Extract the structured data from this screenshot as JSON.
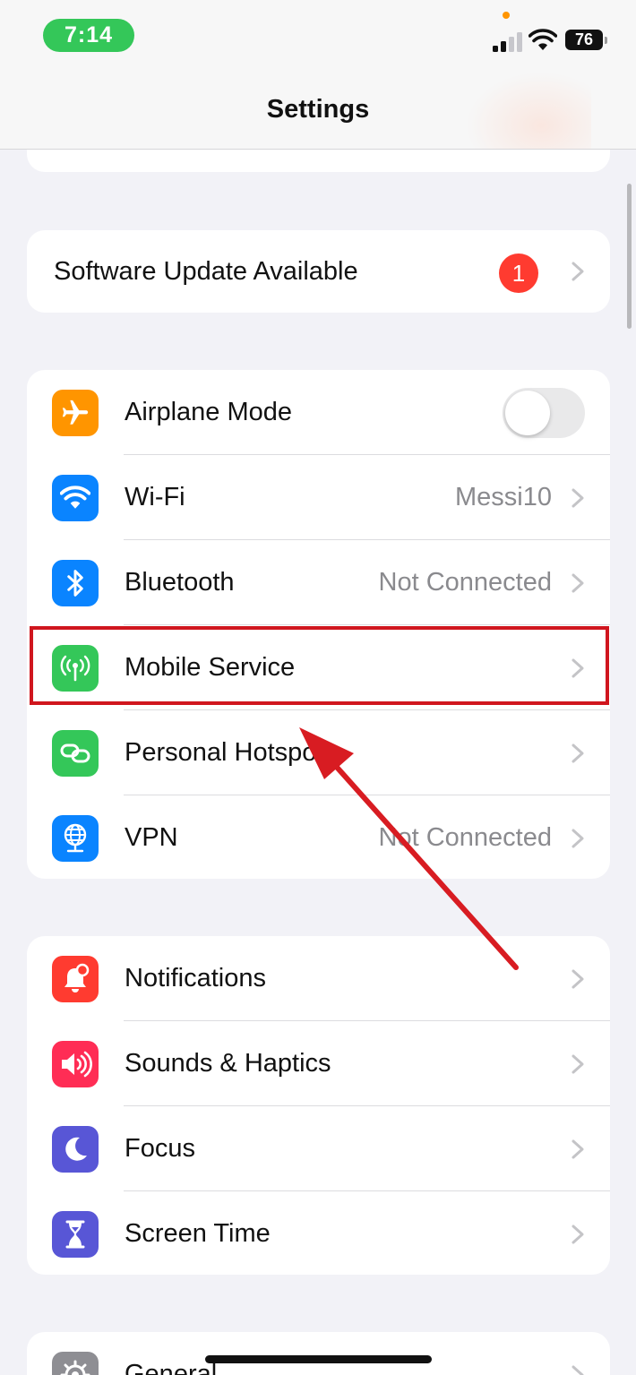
{
  "status_bar": {
    "time": "7:14",
    "battery_level": "76"
  },
  "nav": {
    "title": "Settings"
  },
  "software_update": {
    "label": "Software Update Available",
    "badge_count": "1"
  },
  "connectivity": {
    "airplane": {
      "label": "Airplane Mode",
      "toggle_on": false
    },
    "wifi": {
      "label": "Wi-Fi",
      "value": "Messi10"
    },
    "bluetooth": {
      "label": "Bluetooth",
      "value": "Not Connected"
    },
    "mobile_service": {
      "label": "Mobile Service"
    },
    "hotspot": {
      "label": "Personal Hotspot"
    },
    "vpn": {
      "label": "VPN",
      "value": "Not Connected"
    }
  },
  "alerts": {
    "notifications": {
      "label": "Notifications"
    },
    "sounds": {
      "label": "Sounds & Haptics"
    },
    "focus": {
      "label": "Focus"
    },
    "screen_time": {
      "label": "Screen Time"
    }
  },
  "general": {
    "label": "General"
  },
  "colors": {
    "airplane": "#ff9500",
    "wifi": "#0a84ff",
    "bluetooth": "#0a84ff",
    "mobile": "#34c759",
    "hotspot": "#34c759",
    "vpn": "#0a84ff",
    "notifications": "#ff3b30",
    "sounds": "#ff2d55",
    "focus": "#5856d6",
    "screen_time": "#5856d6",
    "general": "#8e8e93",
    "highlight": "#d0161e"
  }
}
